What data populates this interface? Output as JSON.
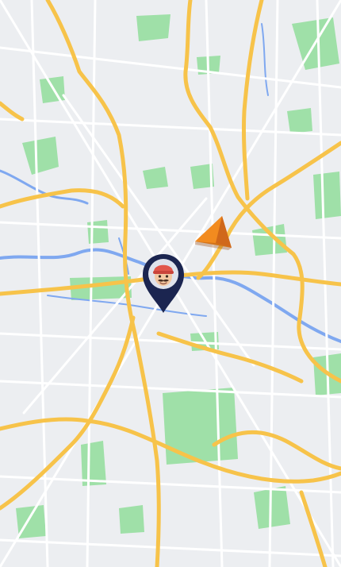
{
  "map": {
    "type": "city-map",
    "colors": {
      "land": "#eceef1",
      "park": "#9fe0a8",
      "water": "#7fa8f0",
      "major_road": "#f7c34a",
      "minor_road": "#ffffff"
    }
  },
  "user_marker": {
    "icon": "memoji-avatar-icon",
    "pin_color": "#1b2550"
  },
  "navigation_marker": {
    "icon": "navigation-arrow-icon",
    "color": "#f28b1f"
  }
}
